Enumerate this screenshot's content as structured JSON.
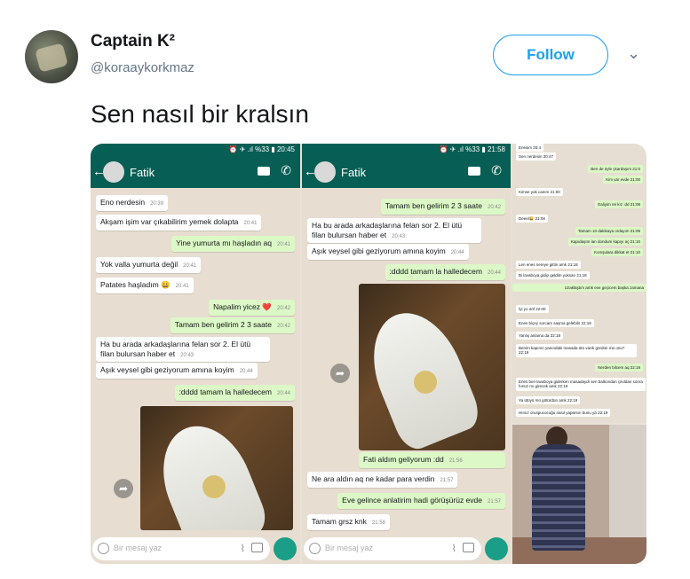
{
  "tweet": {
    "author_name": "Captain K²",
    "author_handle": "@koraaykorkmaz",
    "follow_label": "Follow",
    "text": "Sen nasıl bir kralsın"
  },
  "chat1": {
    "status": "⏰ ✈ .ıl %33 ▮ 20:45",
    "contact": "Fatik",
    "composer_placeholder": "Bir mesaj yaz",
    "messages": [
      {
        "text": "Eno nerdesin",
        "time": "20:39"
      },
      {
        "text": "Akşam işim var çıkabilirim yemek dolapta",
        "time": "20:41"
      },
      {
        "text": "Yine yumurta mı haşladın aq",
        "time": "20:41"
      },
      {
        "text": "Yok valla yumurta değil",
        "time": "20:41"
      },
      {
        "text": "Patates haşladım 😀",
        "time": "20:41"
      },
      {
        "text": "Napalim yicez ❤️",
        "time": "20:42"
      },
      {
        "text": "Tamam ben gelirim 2 3 saate",
        "time": "20:42"
      },
      {
        "text": "Ha bu arada arkadaşlarına felan sor 2. El ütü filan bulursan haber et",
        "time": "20:43"
      },
      {
        "text": "Aşık veysel gibi geziyorum amına koyim",
        "time": "20:44"
      },
      {
        "text": ":dddd tamam la halledecem",
        "time": "20:44"
      }
    ]
  },
  "chat2": {
    "status": "⏰ ✈ .ıl %33 ▮ 21:58",
    "contact": "Fatik",
    "composer_placeholder": "Bir mesaj yaz",
    "messages": [
      {
        "text": "Tamam ben gelirim 2 3 saate",
        "time": "20:42"
      },
      {
        "text": "Ha bu arada arkadaşlarına felan sor 2. El ütü filan bulursan haber et",
        "time": "20:43"
      },
      {
        "text": "Aşık veysel gibi geziyorum amına koyim",
        "time": "20:44"
      },
      {
        "text": ":dddd tamam la halledecem",
        "time": "20:44"
      },
      {
        "text": "Fati aldım geliyorum :dd",
        "time": "21:56"
      },
      {
        "text": "Ne ara aldın aq ne kadar para verdin",
        "time": "21:57"
      },
      {
        "text": "Eve gelince anlatirim hadi görüşürüz evde",
        "time": "21:57"
      },
      {
        "text": "Tamam grsz knk",
        "time": "21:58"
      }
    ]
  },
  "chat3": {
    "messages": [
      {
        "text": "Enesim",
        "time": "20:4"
      },
      {
        "text": "Sen nerdesin",
        "time": "20:47"
      },
      {
        "text": "Ben de öyle çkardaşım",
        "time": "21:0"
      },
      {
        "text": "Kim var evde",
        "time": "21:00"
      },
      {
        "text": "Kimse yok canım",
        "time": "21:00"
      },
      {
        "text": "Galiyim rei kız :dd",
        "time": "21:08"
      },
      {
        "text": "Deeel😀",
        "time": "21:08"
      },
      {
        "text": "Tamam 10 dakikaya ordayım",
        "time": "21:09"
      },
      {
        "text": "Kapıdaşım lan dondum kapıyı aç",
        "time": "21:10"
      },
      {
        "text": "Komşulara dikkat et",
        "time": "21:10"
      },
      {
        "text": "Len enes nereye gittin amk",
        "time": "21:18"
      },
      {
        "text": "Bi lavaboya gidip geldim yoksan",
        "time": "21:18"
      }
    ]
  },
  "chat4": {
    "messages": [
      {
        "text": "Uzaklaştım artık eve geçicem başka zamana",
        "time": ""
      },
      {
        "text": "İyi yo ööf",
        "time": "22:00"
      },
      {
        "text": "Enes biçey sorcam saşma gelebilir",
        "time": "22:18"
      },
      {
        "text": "Yanlış anlama da",
        "time": "22:18"
      },
      {
        "text": "Benim kapının yanındaki masada ütü vardı gördün mü onu?",
        "time": "22:19"
      },
      {
        "text": "Nerden bilcem aq",
        "time": "22:19"
      },
      {
        "text": "Enes ben lavaboya giderken masadaydı sen balkondan çıkıldan sonra hırsız mı girecek amk",
        "time": "22:19"
      },
      {
        "text": "Ya ütüyü mü götürdün amk",
        "time": "22:19"
      },
      {
        "text": "Hırsız oruspucocuğu nasıl yaparsın bunu ya",
        "time": "22:19"
      }
    ]
  },
  "icons": [
    "avatar",
    "chevron-down-icon",
    "back-arrow-icon",
    "video-call-icon",
    "phone-icon",
    "share-icon",
    "emoji-icon",
    "attach-icon",
    "camera-icon",
    "mic-icon"
  ]
}
